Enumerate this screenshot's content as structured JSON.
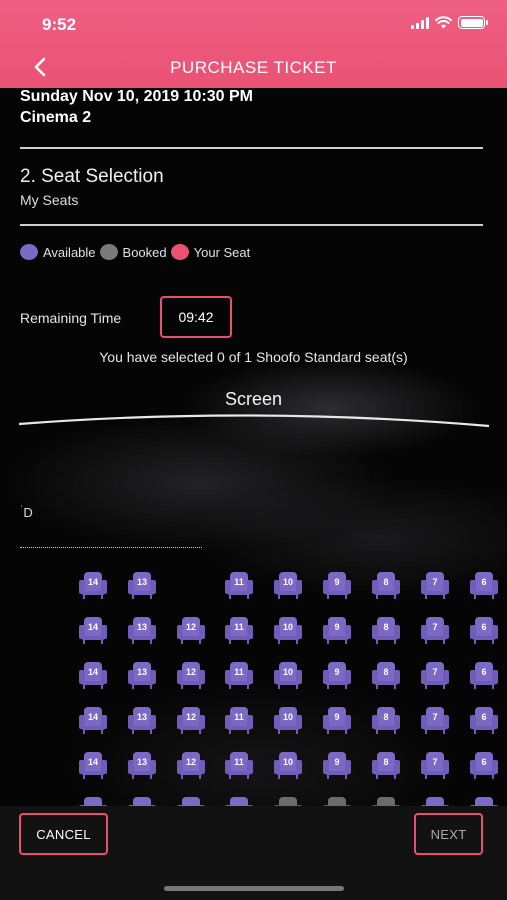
{
  "status_bar": {
    "time": "9:52"
  },
  "header": {
    "title": "PURCHASE TICKET",
    "back_icon": "chevron-left-icon",
    "background": "#ea5274"
  },
  "show": {
    "date_time": "Sunday Nov 10, 2019 10:30 PM",
    "cinema": "Cinema 2"
  },
  "section": {
    "title": "2. Seat Selection",
    "subtitle": "My Seats"
  },
  "legend": [
    {
      "label": "Available",
      "color": "#7c69c6"
    },
    {
      "label": "Booked",
      "color": "#7a7a7a"
    },
    {
      "label": "Your Seat",
      "color": "#ea5274"
    }
  ],
  "timer": {
    "label": "Remaining Time",
    "value": "09:42"
  },
  "selection_info": "You have selected 0 of 1 Shoofo Standard seat(s)",
  "screen_label": "Screen",
  "row_label": "D",
  "seat_rows": [
    [
      "14",
      "13",
      "",
      "11",
      "10",
      "9",
      "8",
      "7",
      "6"
    ],
    [
      "14",
      "13",
      "12",
      "11",
      "10",
      "9",
      "8",
      "7",
      "6"
    ],
    [
      "14",
      "13",
      "12",
      "11",
      "10",
      "9",
      "8",
      "7",
      "6"
    ],
    [
      "14",
      "13",
      "12",
      "11",
      "10",
      "9",
      "8",
      "7",
      "6"
    ],
    [
      "14",
      "13",
      "12",
      "11",
      "10",
      "9",
      "8",
      "7",
      "6"
    ]
  ],
  "partial_row_status": [
    "available",
    "available",
    "available",
    "available",
    "booked",
    "booked",
    "booked",
    "available",
    "available"
  ],
  "buttons": {
    "cancel": "CANCEL",
    "next": "NEXT"
  }
}
